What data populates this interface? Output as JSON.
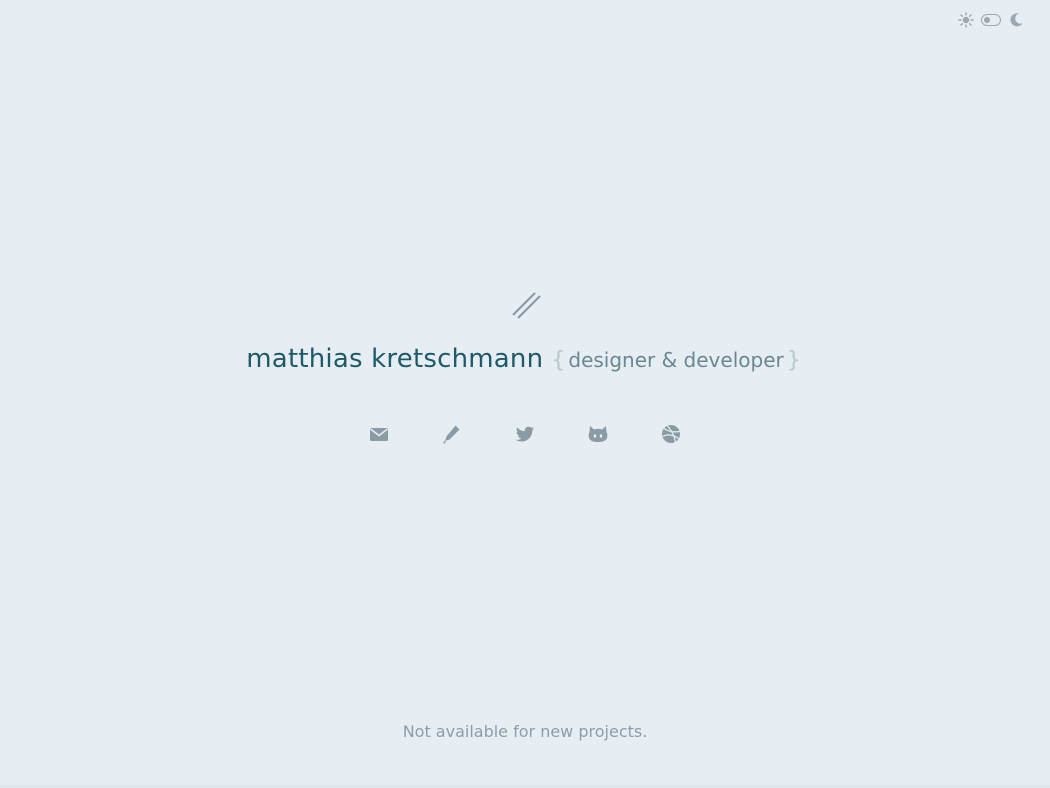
{
  "header": {
    "theme_switch": {
      "light_icon": "sun-icon",
      "dark_icon": "moon-icon",
      "selected": "light"
    }
  },
  "hero": {
    "logo_icon": "double-slash-logo",
    "name": "matthias kretschmann",
    "brace_open": "{",
    "role": "designer & developer",
    "brace_close": "}"
  },
  "social": [
    {
      "icon": "mail-icon"
    },
    {
      "icon": "pencil-icon"
    },
    {
      "icon": "twitter-icon"
    },
    {
      "icon": "github-icon"
    },
    {
      "icon": "dribbble-icon"
    }
  ],
  "footer": {
    "availability": "Not available for new projects."
  },
  "colors": {
    "background": "#e6eef4",
    "name": "#1e5a6a",
    "role": "#6a8792",
    "icons": "#8a9ba5"
  }
}
